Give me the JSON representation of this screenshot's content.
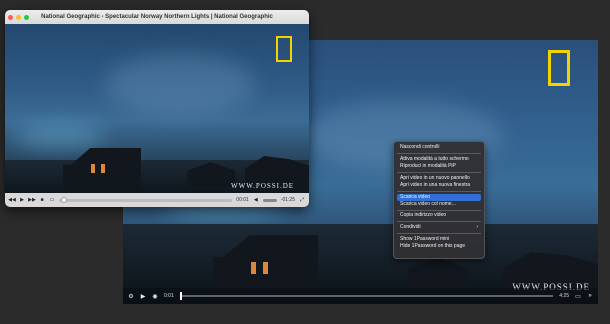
{
  "window": {
    "title": "National Geographic - Spectacular Norway Northern Lights | National Geographic",
    "traffic_colors": [
      "#ff5f57",
      "#febc2e",
      "#28c840"
    ],
    "watermark": "WWW.POSSI.DE",
    "controls": {
      "time_elapsed": "00:01",
      "time_remaining": "-01:25",
      "icons": [
        "rewind-icon",
        "play-icon",
        "fast-forward-icon",
        "stop-icon",
        "subtitles-icon",
        "volume-icon",
        "fullscreen-icon"
      ]
    }
  },
  "background_video": {
    "watermark": "WWW.POSSI.DE",
    "logo_color": "#f2d300",
    "controls": {
      "time_elapsed": "0:01",
      "time_remaining": "4:25",
      "icons": [
        "settings-icon",
        "play-icon",
        "volume-icon",
        "pip-icon",
        "fullscreen-icon"
      ]
    }
  },
  "context_menu": {
    "groups": [
      [
        {
          "label": "Nascondi controlli"
        }
      ],
      [
        {
          "label": "Attiva modalità a tutto schermo"
        },
        {
          "label": "Riproduci in modalità PiP"
        }
      ],
      [
        {
          "label": "Apri video in un nuovo pannello"
        },
        {
          "label": "Apri video in una nuova finestra"
        }
      ],
      [
        {
          "label": "Scarica video",
          "selected": true
        },
        {
          "label": "Scarica video col nome..."
        }
      ],
      [
        {
          "label": "Copia indirizzo video"
        }
      ],
      [
        {
          "label": "Condividi",
          "submenu": true
        }
      ],
      [
        {
          "label": "Show 1Password mini"
        },
        {
          "label": "Hide 1Password on this page"
        }
      ]
    ],
    "highlight_color": "#2f6fd6"
  }
}
